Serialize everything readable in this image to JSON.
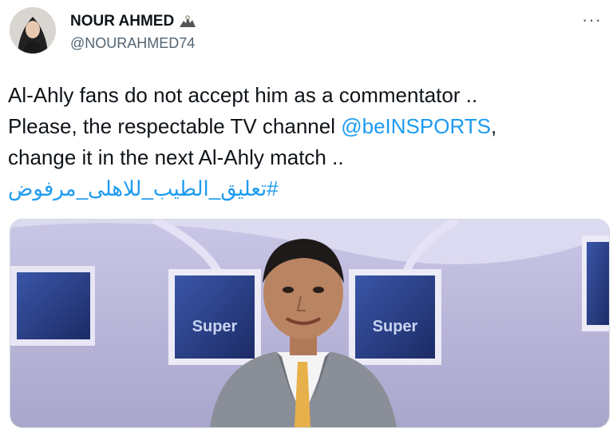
{
  "author": {
    "name": "NOUR AHMED",
    "handle": "@NOURAHMED74",
    "badge_icon": "eagle-icon"
  },
  "menu": {
    "more_label": "···"
  },
  "tweet": {
    "line1": "Al-Ahly fans do not accept him as a commentator ..",
    "line2_prefix": "Please, the respectable TV channel ",
    "mention": "@beINSPORTS",
    "line2_suffix": ",",
    "line3": "change it in the next Al-Ahly match ..",
    "hashtag": "#تعليق_الطيب_للاهلى_مرفوض"
  },
  "media": {
    "screen_logo_left": "Super",
    "screen_logo_right": "Super",
    "colors": {
      "studio": "#b9b6d8",
      "screen": "#2a3f86",
      "suit": "#8a8e96",
      "tie": "#e8b04a"
    }
  },
  "colors": {
    "link": "#1d9bf0",
    "text": "#0f1419",
    "muted": "#536471"
  }
}
